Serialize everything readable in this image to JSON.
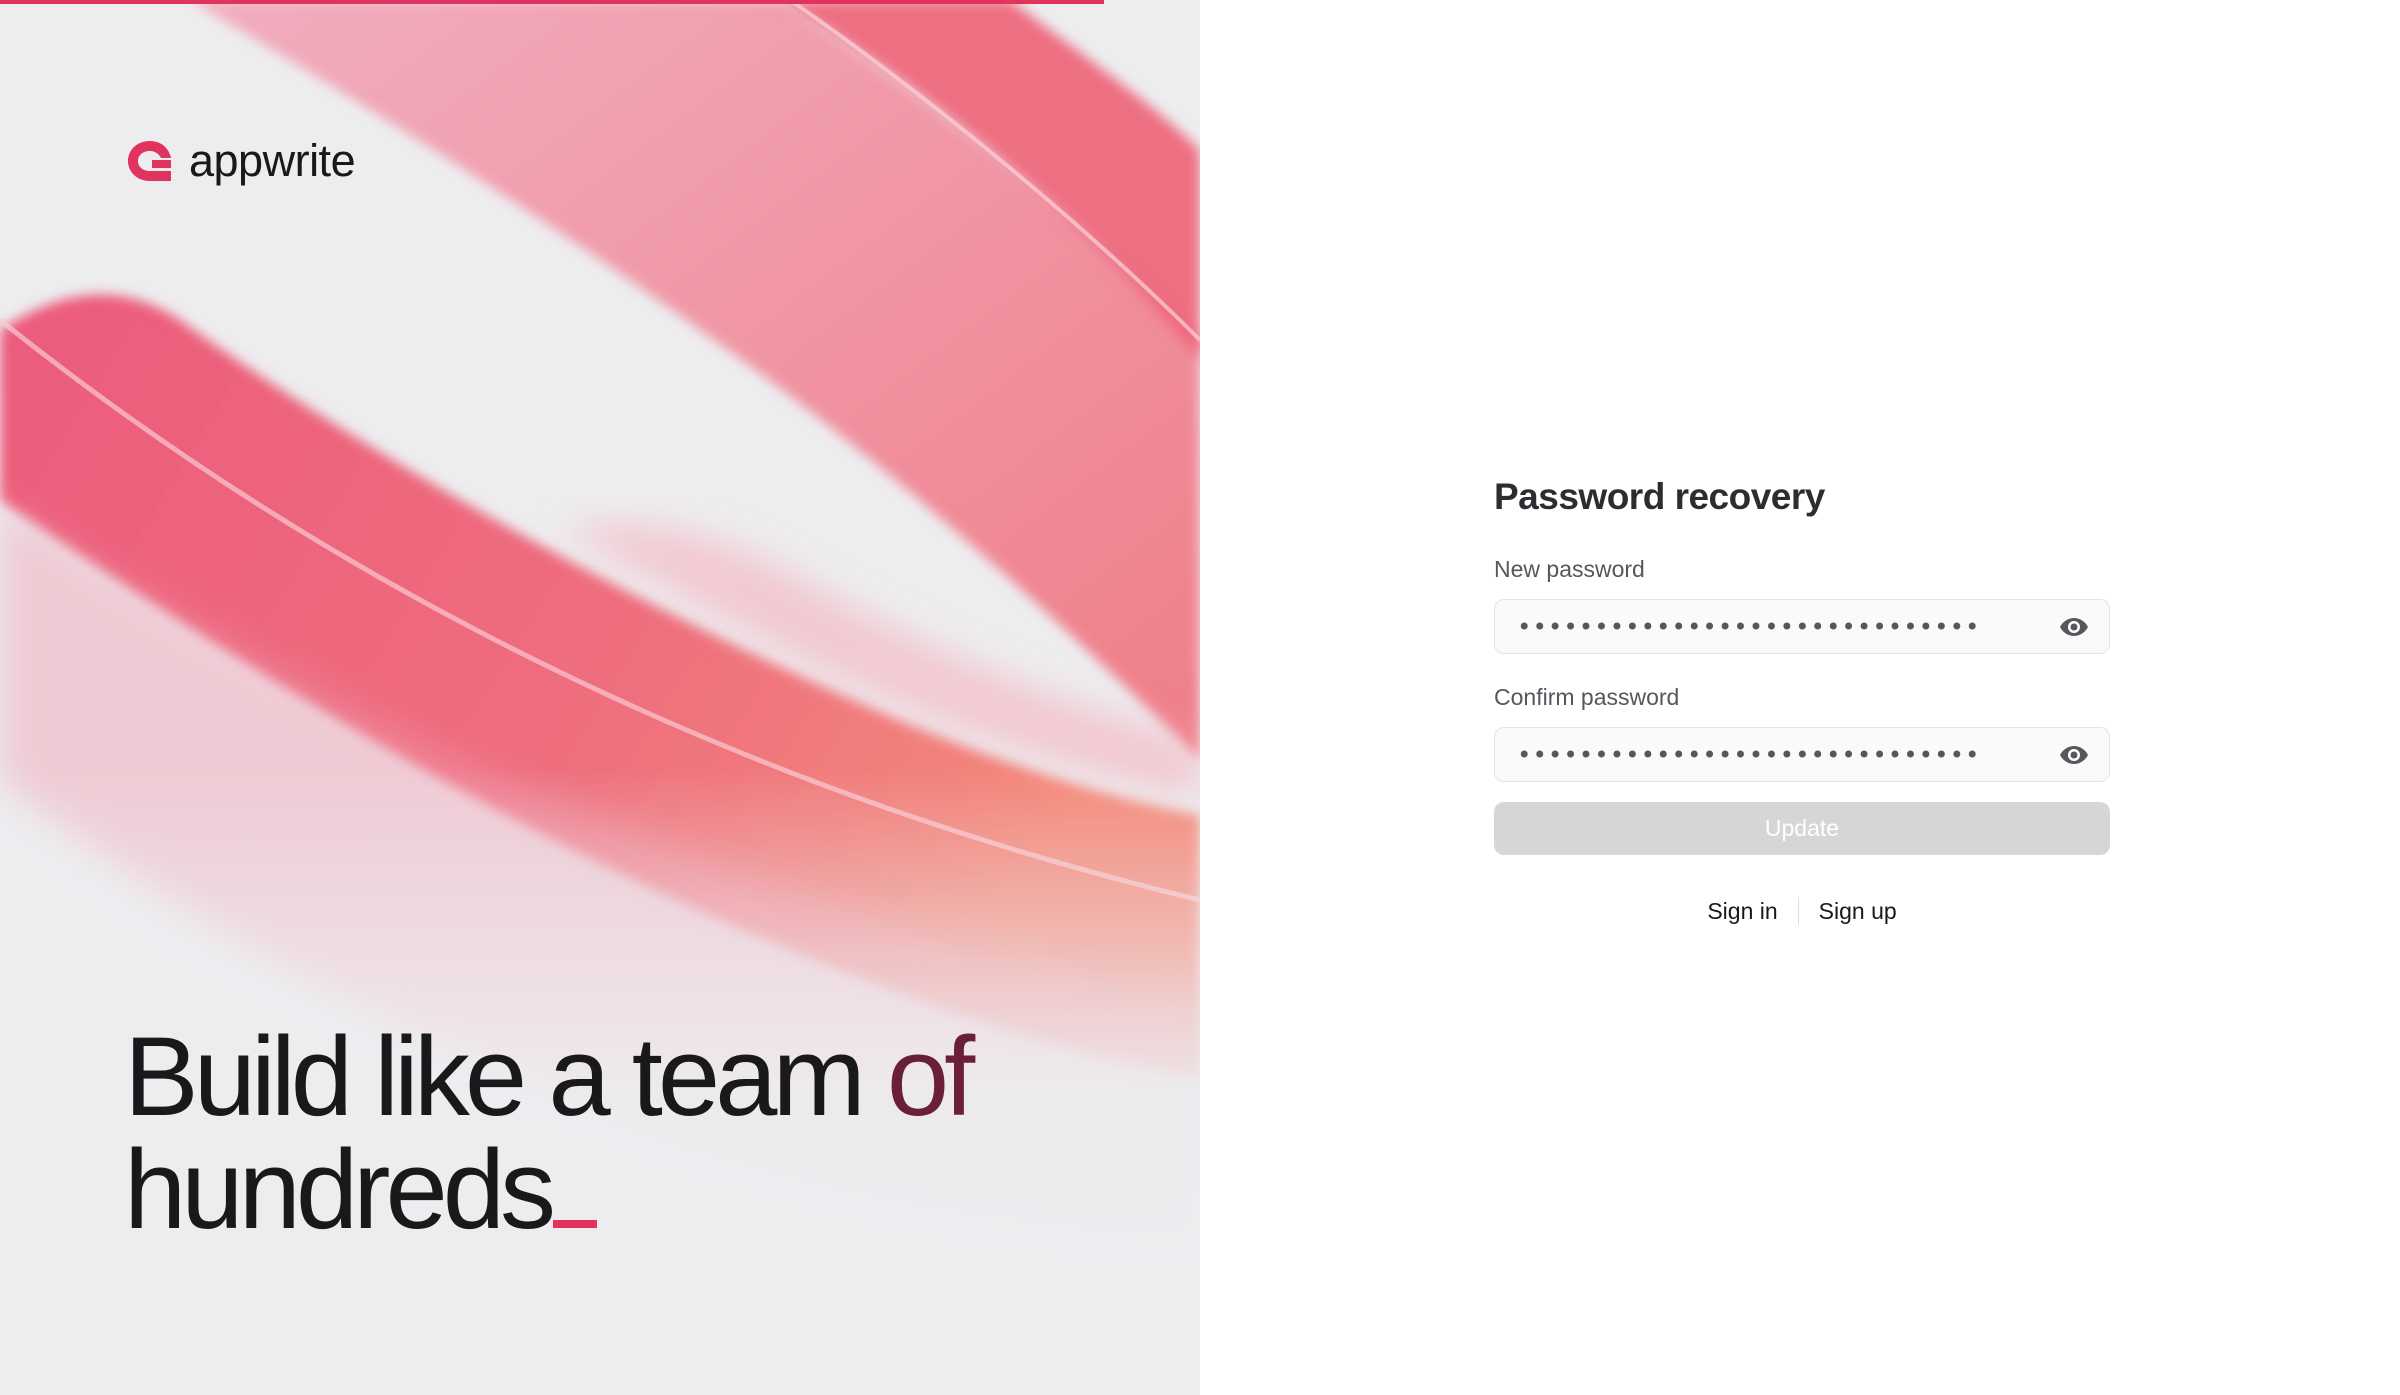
{
  "brand": {
    "name": "appwrite",
    "accent_color": "#e0345e",
    "logo_icon": "appwrite-logo-icon"
  },
  "hero": {
    "line1": "Build like a team",
    "line1_highlight": "of",
    "line2": "hundreds"
  },
  "form": {
    "title": "Password recovery",
    "new_password": {
      "label": "New password",
      "value": "••••••••••••••••••••••••••••••",
      "icon": "eye-icon"
    },
    "confirm_password": {
      "label": "Confirm password",
      "value": "••••••••••••••••••••••••••••••",
      "icon": "eye-icon"
    },
    "submit_label": "Update"
  },
  "links": {
    "sign_in": "Sign in",
    "sign_up": "Sign up"
  }
}
